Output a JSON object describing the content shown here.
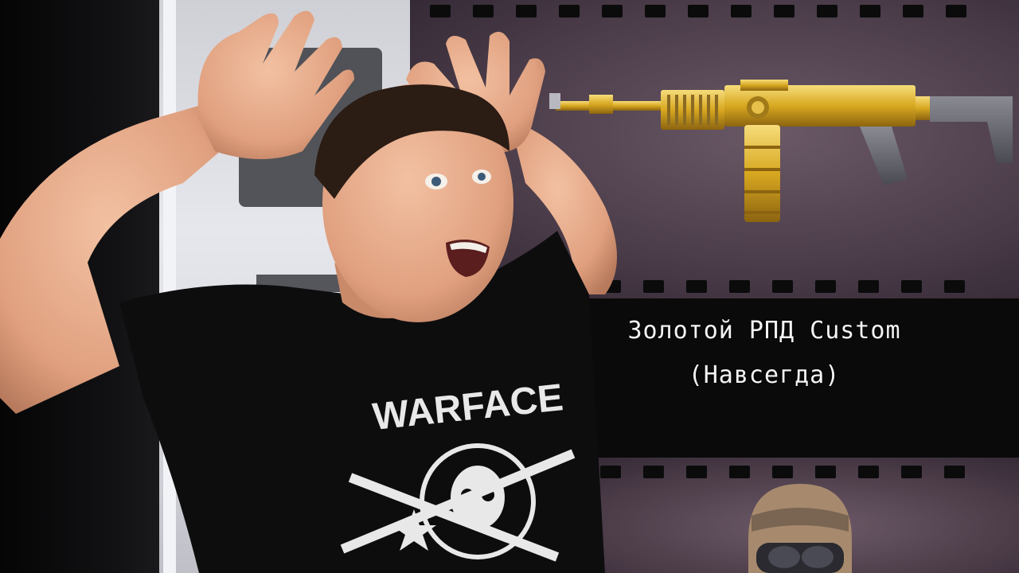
{
  "caption": {
    "line1": "Золотой РПД Custom",
    "line2": "(Навсегда)"
  },
  "shirt": {
    "print_text": "WARFACE"
  },
  "colors": {
    "gold": "#d8a820",
    "gold_light": "#f3d36a",
    "skin": "#e4a585",
    "shirt": "#0d0d0e",
    "film": "#4c3d4a",
    "caption_text": "#f4f4f4"
  }
}
